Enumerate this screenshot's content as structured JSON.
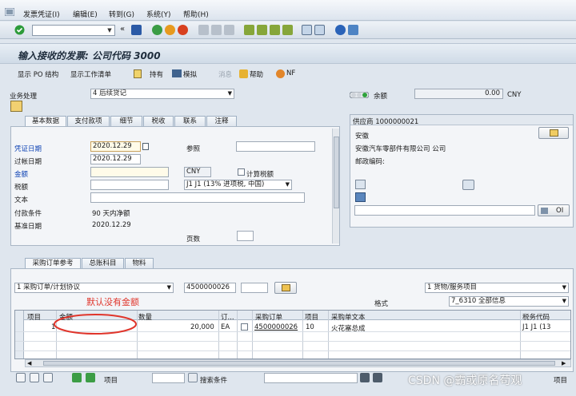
{
  "menu": {
    "items": [
      "发票凭证(I)",
      "编辑(E)",
      "转到(G)",
      "系统(Y)",
      "帮助(H)"
    ]
  },
  "title": "输入接收的发票: 公司代码 3000",
  "app_toolbar": {
    "items": [
      "显示 PO 结构",
      "显示工作清单",
      "持有",
      "模拟",
      "消息",
      "帮助",
      "NF"
    ]
  },
  "transaction": {
    "label": "业务处理",
    "value": "4 后续贷记"
  },
  "balance": {
    "label": "余额",
    "value": "0.00",
    "currency": "CNY"
  },
  "header_tabs": [
    "基本数据",
    "支付款项",
    "细节",
    "税收",
    "联系",
    "注释"
  ],
  "basic": {
    "invoice_date_label": "凭证日期",
    "invoice_date": "2020.12.29",
    "posting_date_label": "过帐日期",
    "posting_date": "2020.12.29",
    "reference_label": "参照",
    "amount_label": "金额",
    "amount_currency": "CNY",
    "calc_tax_label": "计算税额",
    "tax_label": "税额",
    "tax_code": "J1 J1 (13% 进项税, 中国)",
    "text_label": "文本",
    "payment_terms_label": "付款条件",
    "payment_terms": "90 天内净额",
    "baseline_label": "基准日期",
    "baseline_date": "2020.12.29",
    "pages_label": "页数"
  },
  "vendor": {
    "title": "供应商 1000000021",
    "name1": "安徽",
    "name2": "安徽汽车零部件有限公司 公司",
    "postal_label": "邮政编码:",
    "oi_label": "OI"
  },
  "po_tabs": [
    "采购订单参考",
    "总账科目",
    "物料"
  ],
  "po_ref": {
    "ref_type": "1 采购订单/计划协议",
    "po_number": "4500000026",
    "item_type": "1 货物/服务项目",
    "layout_label": "格式",
    "layout_value": "7_6310 全部信息"
  },
  "annotation": "默认没有金额",
  "grid": {
    "headers": [
      "项目",
      "金额",
      "数量",
      "订...",
      "采购订单",
      "项目",
      "采购单文本",
      "税务代码"
    ],
    "rows": [
      {
        "item": "1",
        "amount": "",
        "qty": "20,000",
        "unit": "EA",
        "po": "4500000026",
        "po_item": "10",
        "text": "火花塞总成",
        "tax": "J1  J1 (13"
      }
    ]
  },
  "bottom": {
    "item_label": "项目",
    "search_label": "搜索条件",
    "open_label": "项目"
  },
  "watermark": "CSDN @霸或原名苟观",
  "colors": {
    "required_bg": "#fffbe9",
    "annotation": "#e0352b"
  }
}
